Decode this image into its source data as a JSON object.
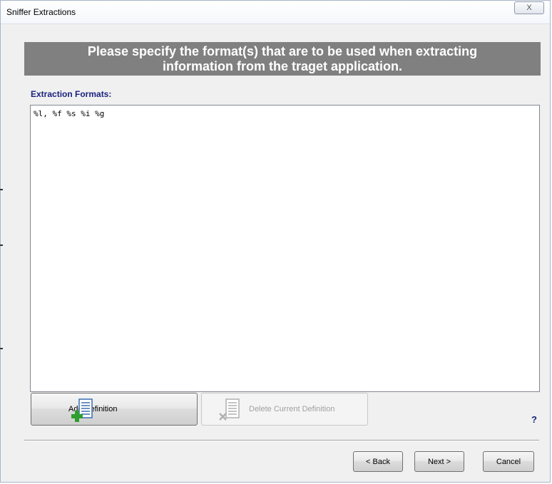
{
  "window": {
    "title": "Sniffer Extractions",
    "close_glyph": "X"
  },
  "banner": {
    "line1": "Please specify the format(s) that are to be used when extracting",
    "line2": "information from the traget application."
  },
  "formats": {
    "label": "Extraction Formats:",
    "value": "%l, %f %s %i %g"
  },
  "actions": {
    "add_label": "Add Definition",
    "delete_label": "Delete Current Definition",
    "help_label": "?"
  },
  "nav": {
    "back_label": "< Back",
    "next_label": "Next >",
    "cancel_label": "Cancel"
  },
  "icons": {
    "add": "add-definition-icon",
    "delete": "delete-definition-icon",
    "close": "close-icon"
  },
  "colors": {
    "banner_bg": "#808080",
    "label_color": "#1a237e",
    "plus_green": "#2e9e2e",
    "delete_gray": "#b0b0b0"
  }
}
